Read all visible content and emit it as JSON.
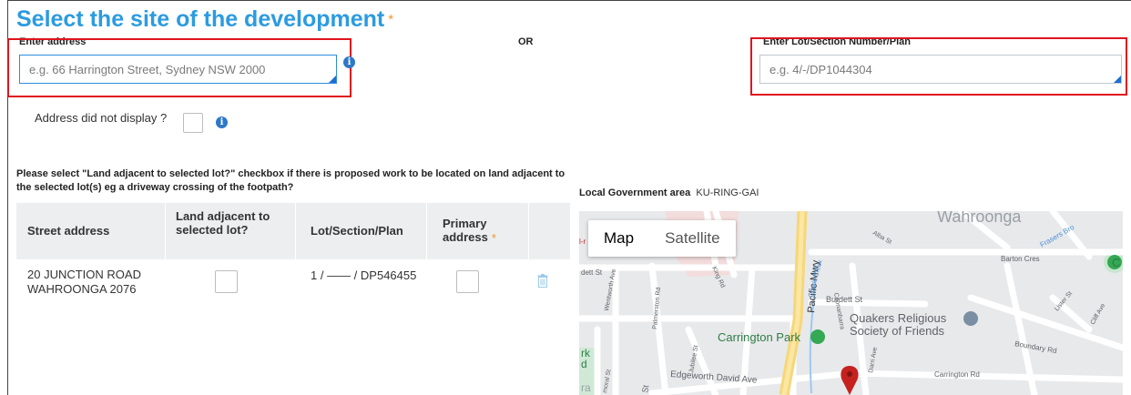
{
  "title": "Select the site of the development",
  "required_mark": "*",
  "address": {
    "label": "Enter address",
    "placeholder": "e.g. 66 Harrington Street, Sydney NSW 2000"
  },
  "or_label": "OR",
  "lot": {
    "label": "Enter Lot/Section Number/Plan",
    "placeholder": "e.g. 4/-/DP1044304"
  },
  "address_not_display_label": "Address did not display ?",
  "info_glyph": "i",
  "instruction": "Please select \"Land adjacent to selected lot?\" checkbox if there is proposed work to be located on land adjacent to the selected lot(s) eg a driveway crossing of the footpath?",
  "table": {
    "headers": {
      "street": "Street address",
      "land_adjacent": "Land adjacent to selected lot?",
      "lot_plan": "Lot/Section/Plan",
      "primary": "Primary address"
    },
    "rows": [
      {
        "street": "20 JUNCTION ROAD WAHROONGA 2076",
        "lot_plan": "1 / —— / DP546455"
      }
    ]
  },
  "lga": {
    "label": "Local Government area",
    "value": "KU-RING-GAI"
  },
  "map": {
    "tabs": [
      "Map",
      "Satellite"
    ],
    "active_tab": "Map",
    "labels": {
      "wahroonga": "Wahroonga",
      "pacific_mwy": "Pacific Mwy",
      "burdett": "Burdett St",
      "quakers_1": "Quakers Religious",
      "quakers_2": "Society of Friends",
      "carrington_park": "Carrington Park",
      "edgeworth": "Edgeworth David Ave",
      "carrington_rd": "Carrington Rd",
      "boundary": "Boundary Rd",
      "barton": "Barton Cres",
      "frasers": "Frasers Bro",
      "dett": "dett St",
      "wentworth": "Wentworth Ave",
      "palmerston": "Palmerston Rd",
      "jubilee": "Jubilee St",
      "cockle": "Cockle Creek",
      "coonanbarra": "Coonanbarra",
      "lister": "Lister St",
      "cliff": "Cliff Ave",
      "king": "King Rd",
      "dt": "Dt",
      "rk": "rk",
      "d": "d",
      "ra": "ra",
      "moral": "moral St",
      "st": "St",
      "darri": "Darri Ave",
      "alba": "Alba St",
      "c": "C",
      "edge_left": "l-r"
    }
  },
  "colors": {
    "accent": "#2c9be0",
    "required": "#f0962b",
    "highlight": "#e0141e",
    "map_pin": "#c5221f"
  }
}
